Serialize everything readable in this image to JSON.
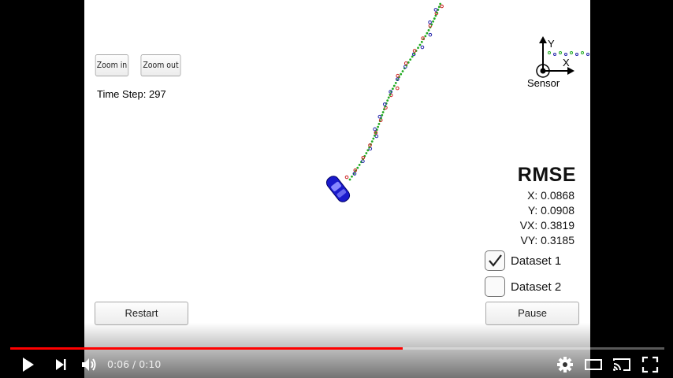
{
  "sim": {
    "zoom_in_label": "Zoom in",
    "zoom_out_label": "Zoom out",
    "time_step": "Time Step: 297",
    "sensor_label": "Sensor",
    "axis_y": "Y",
    "axis_x": "X",
    "rmse": {
      "title": "RMSE",
      "x": "X: 0.0868",
      "y": "Y: 0.0908",
      "vx": "VX: 0.3819",
      "vy": "VY: 0.3185"
    },
    "datasets": [
      {
        "label": "Dataset 1",
        "checked": true
      },
      {
        "label": "Dataset 2",
        "checked": false
      }
    ],
    "restart_label": "Restart",
    "pause_label": "Pause",
    "colors": {
      "estimate": "#22aa22",
      "lidar": "#cc2222",
      "radar": "#2222aa",
      "car": "#1a1acc"
    }
  },
  "player": {
    "time": "0:06 / 0:10",
    "progress": 0.6,
    "progress_color": "#ff0000",
    "icons": [
      "play-icon",
      "next-icon",
      "volume-icon",
      "settings-icon",
      "theater-icon",
      "cast-icon",
      "fullscreen-icon"
    ]
  }
}
